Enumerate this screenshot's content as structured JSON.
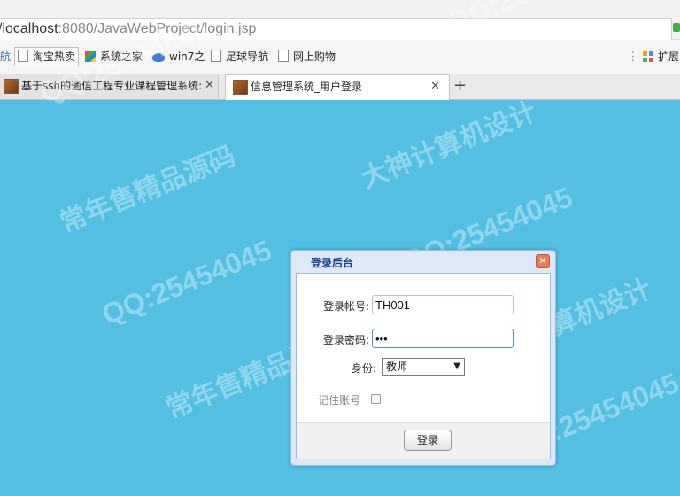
{
  "browser": {
    "url_host": "/localhost",
    "url_port": ":8080",
    "url_path": "/JavaWebProject/login.jsp"
  },
  "bookmarks": {
    "first_partial": "航",
    "items": [
      {
        "label": "淘宝热卖",
        "icon": "page-icon"
      },
      {
        "label": "系统之家",
        "icon": "windows-logo-icon"
      },
      {
        "label": "win7之",
        "icon": "win7-icon"
      },
      {
        "label": "足球导航",
        "icon": "page-icon"
      },
      {
        "label": "网上购物",
        "icon": "page-icon"
      }
    ],
    "extensions_label": "扩展"
  },
  "tabs": [
    {
      "title": "基于ssh的通信工程专业课程管理系统:",
      "active": false
    },
    {
      "title": "信息管理系统_用户登录",
      "active": true
    }
  ],
  "watermark": {
    "qq": "QQ:25454045",
    "qq_full": "QQ:25454045",
    "cn1": "常年售精品源码",
    "cn2": "大神计算机设计"
  },
  "dialog": {
    "title": "登录后台",
    "account_label": "登录帐号:",
    "account_value": "TH001",
    "password_label": "登录密码:",
    "password_value": "•••",
    "role_label": "身份:",
    "role_selected": "教师",
    "remember_label": "记住账号",
    "login_button": "登录"
  },
  "colors": {
    "page_background": "#52bfe3",
    "dialog_title": "#15428b"
  }
}
